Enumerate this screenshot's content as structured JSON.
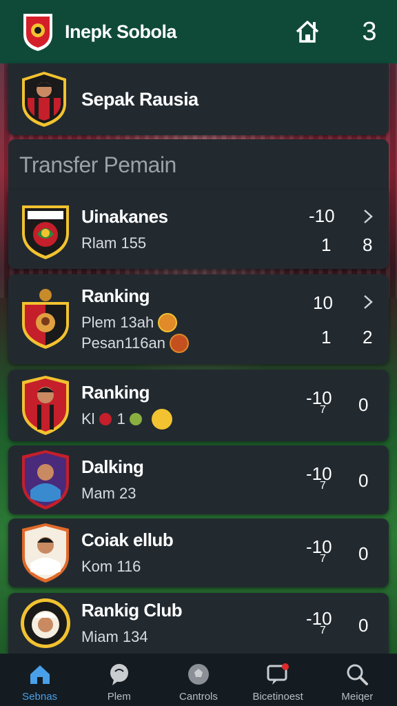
{
  "header": {
    "app_title": "Inepk Sobola",
    "count": "3"
  },
  "featured": {
    "title": "Sepak Rausia"
  },
  "section": {
    "title": "Transfer Pemain"
  },
  "rows": [
    {
      "title": "Uinakanes",
      "sub1": "Rlam 155",
      "sub2": "",
      "stat_top": "-10",
      "stat_top_right": "",
      "stat_bottom_left": "1",
      "stat_bottom_right": "8"
    },
    {
      "title": "Ranking",
      "sub1": "Plem 13ah",
      "sub2": "Pesan116an",
      "stat_top": "10",
      "stat_top_right": "",
      "stat_bottom_left": "1",
      "stat_bottom_right": "2"
    },
    {
      "title": "Ranking",
      "sub1": "Kl",
      "sub1b": "1",
      "sub2": "",
      "stat_top": "-10",
      "stat_top_sub": "7",
      "stat_right": "0"
    },
    {
      "title": "Dalking",
      "sub1": "Mam 23",
      "sub2": "",
      "stat_top": "-10",
      "stat_top_sub": "7",
      "stat_right": "0"
    },
    {
      "title": "Coiak ellub",
      "sub1": "Kom 116",
      "sub2": "",
      "stat_top": "-10",
      "stat_top_sub": "7",
      "stat_right": "0"
    },
    {
      "title": "Rankig Club",
      "sub1": "Miam 134",
      "sub2": "",
      "stat_top": "-10",
      "stat_top_sub": "7",
      "stat_right": "0"
    }
  ],
  "nav": [
    {
      "label": "Sebnas",
      "icon": "home-icon",
      "active": true
    },
    {
      "label": "Plem",
      "icon": "chat-icon"
    },
    {
      "label": "Cantrols",
      "icon": "ball-icon"
    },
    {
      "label": "Bicetinoest",
      "icon": "message-icon"
    },
    {
      "label": "Meiqer",
      "icon": "search-icon"
    }
  ],
  "colors": {
    "header_bg": "#0f4a38",
    "card_bg": "#222a30",
    "accent": "#4aa0e8"
  }
}
